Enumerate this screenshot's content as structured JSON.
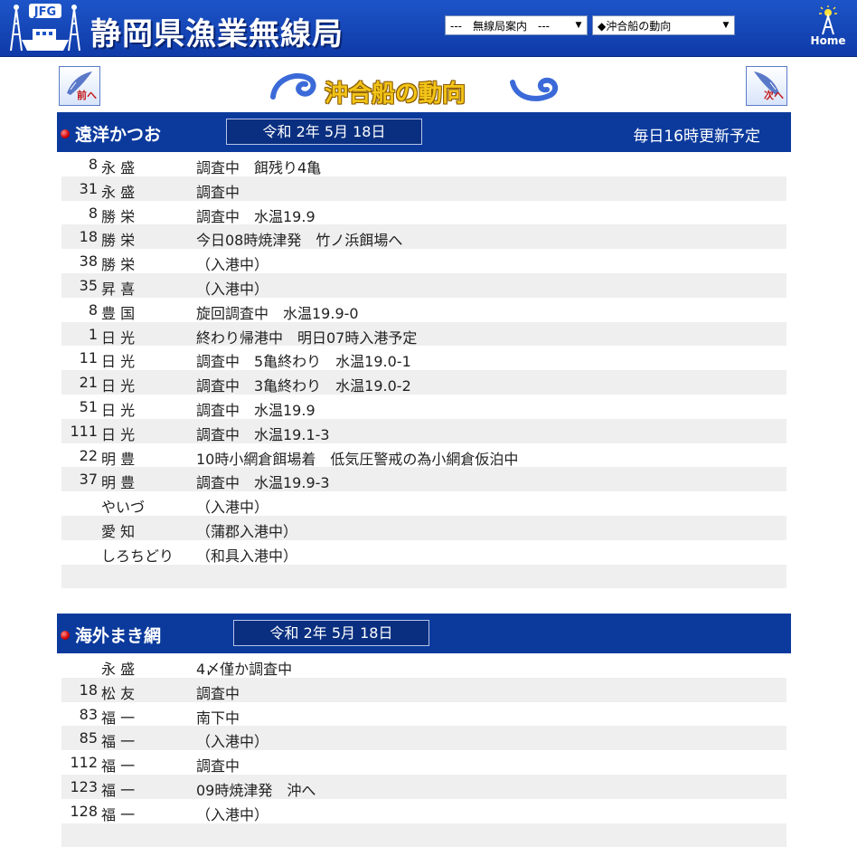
{
  "header": {
    "logo_text": "JFG",
    "site_title": "静岡県漁業無線局",
    "select1": "---　無線局案内　---",
    "select2": "◆沖合船の動向",
    "home_label": "Home",
    "colors": {
      "bar": "#1d55c8",
      "title_text": "#ffffff"
    }
  },
  "banner": {
    "title": "沖合船の動向",
    "prev_label": "前へ",
    "next_label": "次へ"
  },
  "sections": [
    {
      "name": "遠洋かつお",
      "date": "令和 2年 5月 18日",
      "note": "毎日16時更新予定",
      "rows": [
        {
          "num": "8",
          "name": "永 盛",
          "status": "調査中　餌残り4亀"
        },
        {
          "num": "31",
          "name": "永 盛",
          "status": "調査中"
        },
        {
          "num": "8",
          "name": "勝 栄",
          "status": "調査中　水温19.9"
        },
        {
          "num": "18",
          "name": "勝 栄",
          "status": "今日08時焼津発　竹ノ浜餌場へ"
        },
        {
          "num": "38",
          "name": "勝 栄",
          "status": "（入港中）"
        },
        {
          "num": "35",
          "name": "昇 喜",
          "status": "（入港中）"
        },
        {
          "num": "8",
          "name": "豊 国",
          "status": "旋回調査中　水温19.9-0"
        },
        {
          "num": "1",
          "name": "日 光",
          "status": "終わり帰港中　明日07時入港予定"
        },
        {
          "num": "11",
          "name": "日 光",
          "status": "調査中　5亀終わり　水温19.0-1"
        },
        {
          "num": "21",
          "name": "日 光",
          "status": "調査中　3亀終わり　水温19.0-2"
        },
        {
          "num": "51",
          "name": "日 光",
          "status": "調査中　水温19.9"
        },
        {
          "num": "111",
          "name": "日 光",
          "status": "調査中　水温19.1-3"
        },
        {
          "num": "22",
          "name": "明 豊",
          "status": "10時小網倉餌場着　低気圧警戒の為小網倉仮泊中"
        },
        {
          "num": "37",
          "name": "明 豊",
          "status": "調査中　水温19.9-3"
        },
        {
          "num": "",
          "name": "やいづ",
          "status": "（入港中）"
        },
        {
          "num": "",
          "name": "愛 知",
          "status": "（蒲郡入港中）"
        },
        {
          "num": "",
          "name": "しろちどり",
          "status": "（和具入港中）"
        },
        {
          "num": "",
          "name": "",
          "status": ""
        }
      ]
    },
    {
      "name": "海外まき網",
      "date": "令和 2年 5月 18日",
      "note": "",
      "rows": [
        {
          "num": "",
          "name": "永 盛",
          "status": "4〆僅か調査中"
        },
        {
          "num": "18",
          "name": "松 友",
          "status": "調査中"
        },
        {
          "num": "83",
          "name": "福 一",
          "status": "南下中"
        },
        {
          "num": "85",
          "name": "福 一",
          "status": "（入港中）"
        },
        {
          "num": "112",
          "name": "福 一",
          "status": "調査中"
        },
        {
          "num": "123",
          "name": "福 一",
          "status": "09時焼津発　沖へ"
        },
        {
          "num": "128",
          "name": "福 一",
          "status": "（入港中）"
        },
        {
          "num": "",
          "name": "",
          "status": ""
        }
      ]
    }
  ]
}
